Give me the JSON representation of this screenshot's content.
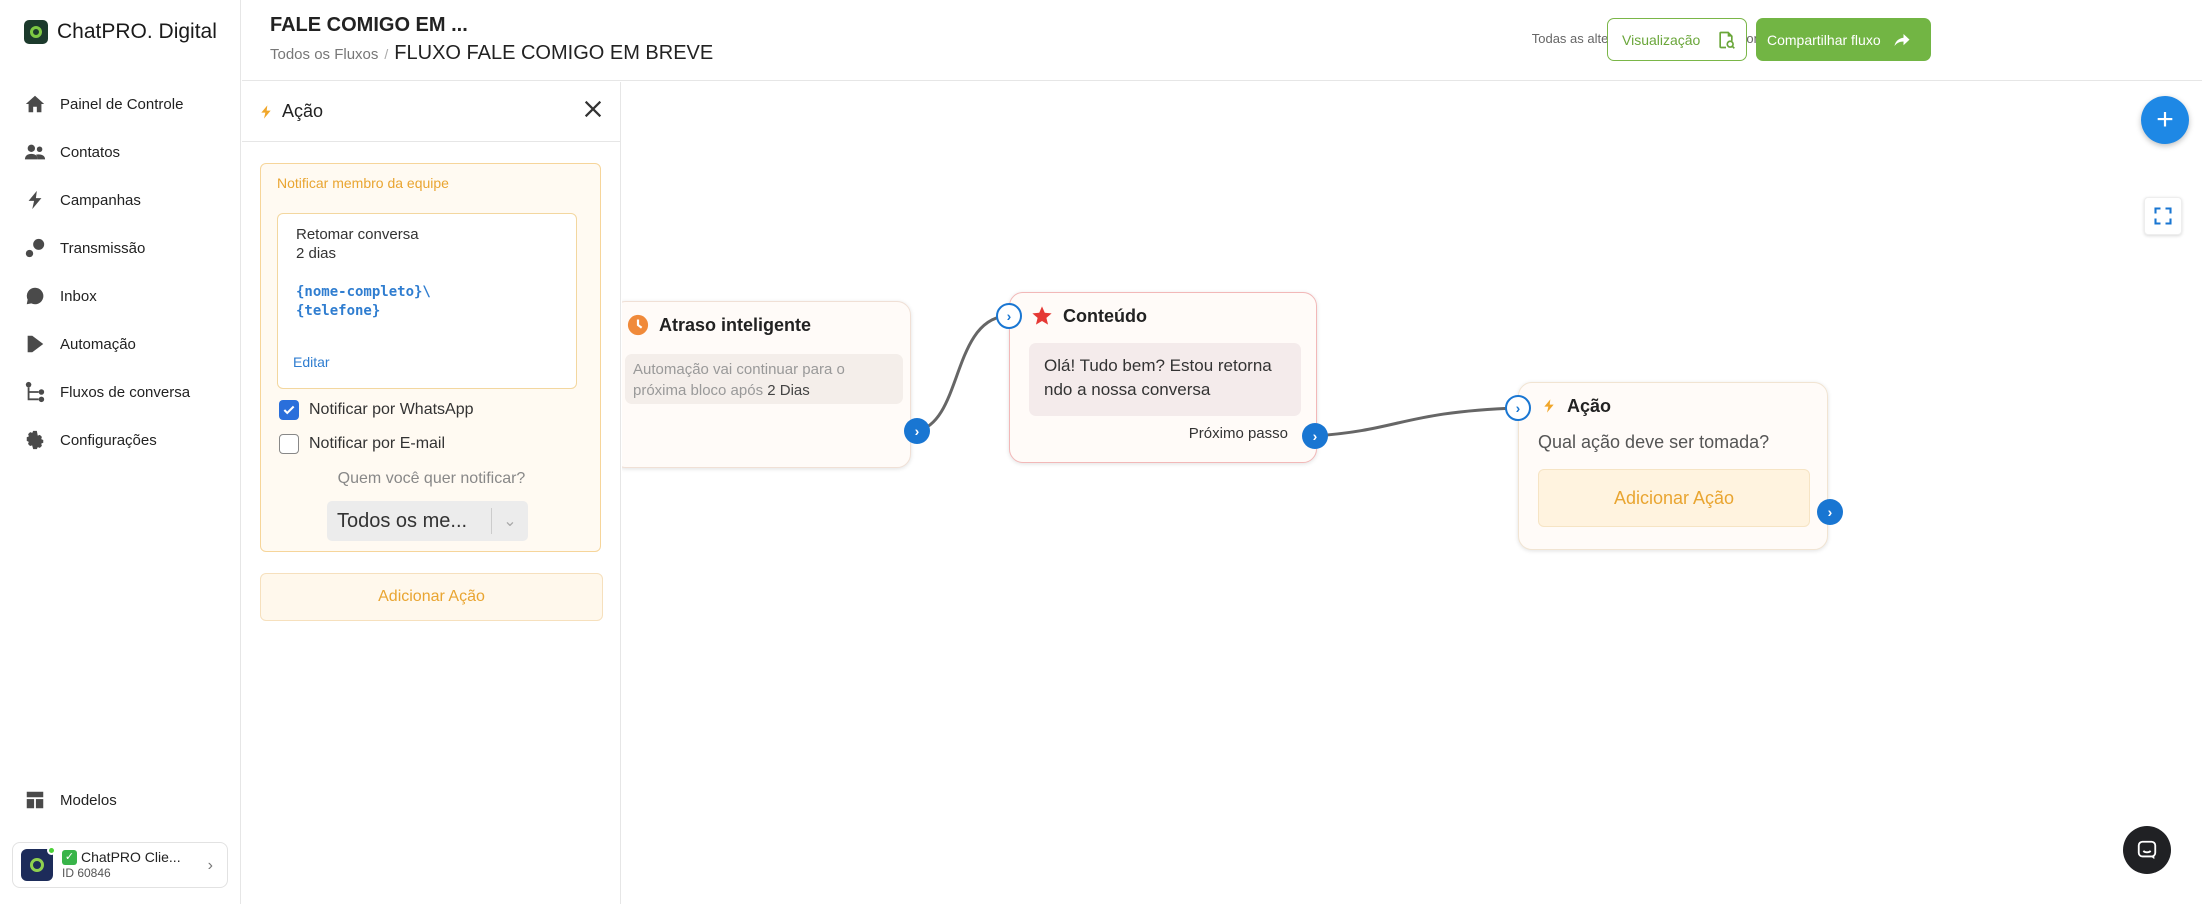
{
  "brand": {
    "name": "ChatPRO. Digital"
  },
  "sidebar": {
    "items": [
      {
        "label": "Painel de Controle",
        "icon": "home-icon"
      },
      {
        "label": "Contatos",
        "icon": "contacts-icon"
      },
      {
        "label": "Campanhas",
        "icon": "bolt-icon"
      },
      {
        "label": "Transmissão",
        "icon": "broadcast-icon"
      },
      {
        "label": "Inbox",
        "icon": "chat-bubble-icon"
      },
      {
        "label": "Automação",
        "icon": "play-icon"
      },
      {
        "label": "Fluxos de conversa",
        "icon": "flow-icon"
      },
      {
        "label": "Configurações",
        "icon": "gear-icon"
      }
    ],
    "models_label": "Modelos"
  },
  "account": {
    "name": "ChatPRO Clie...",
    "id": "ID 60846"
  },
  "header": {
    "title": "FALE COMIGO EM ...",
    "breadcrumb_root": "Todos os Fluxos",
    "breadcrumb_sep": "/",
    "breadcrumb_current": "FLUXO FALE COMIGO EM BREVE",
    "saved_status": "Todas as alterações foram salvas automaticamente",
    "preview_label": "Visualização",
    "share_label": "Compartilhar fluxo"
  },
  "panel": {
    "title": "Ação",
    "notify_label": "Notificar membro da equipe",
    "message_line1": "Retomar conversa",
    "message_line2": "2 dias",
    "message_vars": "{nome-completo}\\\n{telefone}",
    "edit_label": "Editar",
    "whatsapp_label": "Notificar por WhatsApp",
    "whatsapp_checked": true,
    "email_label": "Notificar por E-mail",
    "email_checked": false,
    "who_label": "Quem você quer notificar?",
    "who_value": "Todos os me...",
    "add_action_label": "Adicionar Ação"
  },
  "canvas": {
    "delay_node": {
      "title": "Atraso inteligente",
      "text": "Automação vai continuar para o próxima bloco após",
      "value": "2 Dias"
    },
    "content_node": {
      "title": "Conteúdo",
      "message": "Olá! Tudo bem? Estou retorna ndo a nossa conversa",
      "next_label": "Próximo passo"
    },
    "action_node": {
      "title": "Ação",
      "question": "Qual ação deve ser tomada?",
      "add_label": "Adicionar Ação"
    }
  },
  "colors": {
    "accent": "#1976d2",
    "green": "#72b544",
    "orange": "#e9a531"
  }
}
